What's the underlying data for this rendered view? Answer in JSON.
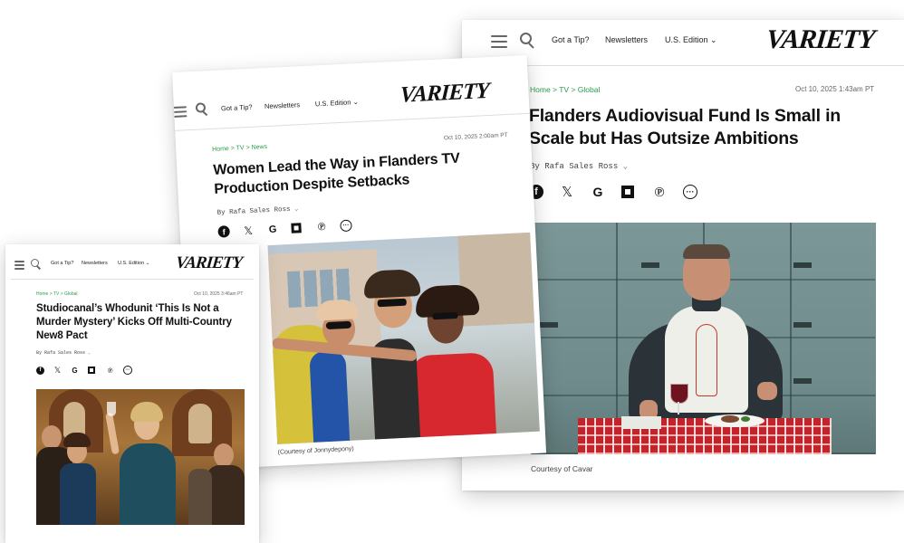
{
  "nav": {
    "tip": "Got a Tip?",
    "newsletters": "Newsletters",
    "edition": "U.S. Edition",
    "logo": "VARIETY"
  },
  "articles": [
    {
      "breadcrumb": "Home > TV > Global",
      "date": "Oct 10, 2025 1:43am PT",
      "headline": "Flanders Audiovisual Fund Is Small in Scale but Has Outsize Ambitions",
      "byline": "By Rafa Sales Ross",
      "caption": "Courtesy of Cavar"
    },
    {
      "breadcrumb": "Home > TV > News",
      "date": "Oct 10, 2025 2:00am PT",
      "headline": "Women Lead the Way in Flanders TV Production Despite Setbacks",
      "byline": "By Rafa Sales Ross",
      "caption": "(Courtesy of Jonnydepony)"
    },
    {
      "breadcrumb": "Home > TV > Global",
      "date": "Oct 10, 2025 3:46am PT",
      "headline": "Studiocanal’s Whodunit ‘This Is Not a Murder Mystery’ Kicks Off Multi-Country New8 Pact",
      "byline": "By Rafa Sales Ross"
    }
  ],
  "share_icons": [
    "facebook-icon",
    "x-icon",
    "google-icon",
    "flipboard-icon",
    "pinterest-icon",
    "more-icon"
  ],
  "colors": {
    "breadcrumb": "#2a9d4b",
    "accent_red": "#d7282f"
  }
}
